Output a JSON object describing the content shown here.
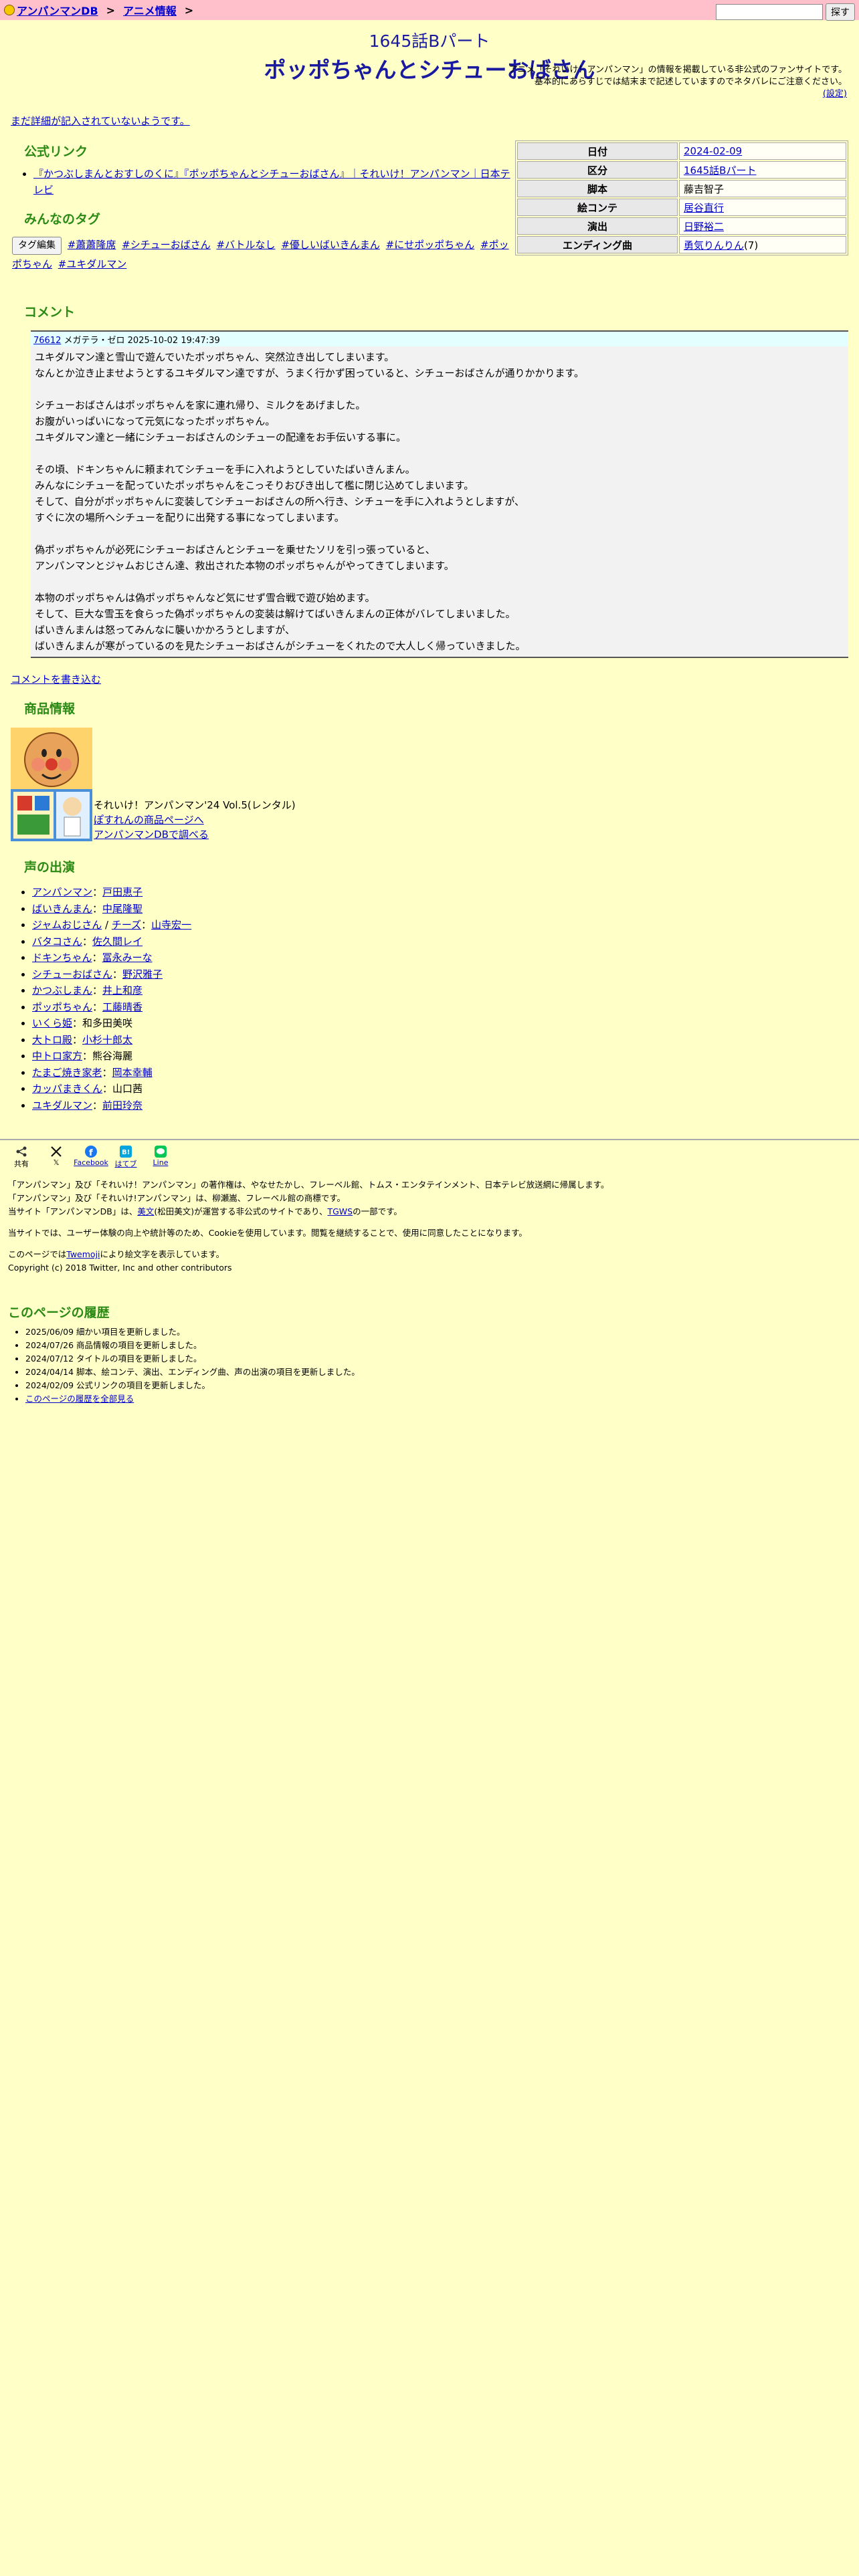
{
  "nav": {
    "crumbs": [
      "アンパンマンDB",
      "アニメ情報"
    ],
    "separator": ">",
    "search_button": "探す"
  },
  "page": {
    "subtitle": "1645話Bパート",
    "title": "ポッポちゃんとシチューおばさん",
    "notice_line1": "アニメ「それいけ！アンパンマン」の情報を掲載している非公式のファンサイトです。",
    "notice_line2": "基本的にあらすじでは結末まで記述していますのでネタバレにご注意ください。",
    "settings_link": "(設定)",
    "no_detail": "まだ詳細が記入されていないようです。"
  },
  "official_links": {
    "heading": "公式リンク",
    "items": [
      "『かつぶしまんとおすしのくに』『ポッポちゃんとシチューおばさん』｜それいけ！アンパンマン｜日本テレビ"
    ]
  },
  "tags": {
    "heading": "みんなのタグ",
    "edit_button": "タグ編集",
    "items": [
      "#蕭蕭隆席",
      "#シチューおばさん",
      "#バトルなし",
      "#優しいばいきんまん",
      "#にせポッポちゃん",
      "#ポッポちゃん",
      "#ユキダルマン"
    ]
  },
  "info": {
    "rows": [
      {
        "label": "日付",
        "value": "2024-02-09",
        "link": true
      },
      {
        "label": "区分",
        "value": "1645話Bパート",
        "link": true
      },
      {
        "label": "脚本",
        "value": "藤吉智子",
        "link": false
      },
      {
        "label": "絵コンテ",
        "value": "居谷直行",
        "link": true
      },
      {
        "label": "演出",
        "value": "日野裕二",
        "link": true
      },
      {
        "label": "エンディング曲",
        "value": "勇気りんりん",
        "suffix": "(7)",
        "link": true
      }
    ]
  },
  "comments": {
    "heading": "コメント",
    "items": [
      {
        "id": "76612",
        "author": "メガテラ・ゼロ",
        "date": "2025-10-02 19:47:39",
        "body": "ユキダルマン達と雪山で遊んでいたポッポちゃん、突然泣き出してしまいます。\nなんとか泣き止ませようとするユキダルマン達ですが、うまく行かず困っていると、シチューおばさんが通りかかります。\n\nシチューおばさんはポッポちゃんを家に連れ帰り、ミルクをあげました。\nお腹がいっぱいになって元気になったポッポちゃん。\nユキダルマン達と一緒にシチューおばさんのシチューの配達をお手伝いする事に。\n\nその頃、ドキンちゃんに頼まれてシチューを手に入れようとしていたばいきんまん。\nみんなにシチューを配っていたポッポちゃんをこっそりおびき出して檻に閉じ込めてしまいます。\nそして、自分がポッポちゃんに変装してシチューおばさんの所へ行き、シチューを手に入れようとしますが、\nすぐに次の場所へシチューを配りに出発する事になってしまいます。\n\n偽ポッポちゃんが必死にシチューおばさんとシチューを乗せたソリを引っ張っていると、\nアンパンマンとジャムおじさん達、救出された本物のポッポちゃんがやってきてしまいます。\n\n本物のポッポちゃんは偽ポッポちゃんなど気にせず雪合戦で遊び始めます。\nそして、巨大な雪玉を食らった偽ポッポちゃんの変装は解けてばいきんまんの正体がバレてしまいました。\nばいきんまんは怒ってみんなに襲いかかろうとしますが、\nばいきんまんが寒がっているのを見たシチューおばさんがシチューをくれたので大人しく帰っていきました。"
      }
    ],
    "write_link": "コメントを書き込む"
  },
  "product": {
    "heading": "商品情報",
    "name": "それいけ！アンパンマン'24 Vol.5(レンタル)",
    "link1": "ぽすれんの商品ページへ",
    "link2": "アンパンマンDBで調べる"
  },
  "voices": {
    "heading": "声の出演",
    "items": [
      {
        "roles": [
          "アンパンマン"
        ],
        "actors": [
          "戸田恵子"
        ]
      },
      {
        "roles": [
          "ばいきんまん"
        ],
        "actors": [
          "中尾隆聖"
        ]
      },
      {
        "roles": [
          "ジャムおじさん",
          "チーズ"
        ],
        "actors": [
          "山寺宏一"
        ]
      },
      {
        "roles": [
          "バタコさん"
        ],
        "actors": [
          "佐久間レイ"
        ]
      },
      {
        "roles": [
          "ドキンちゃん"
        ],
        "actors": [
          "冨永みーな"
        ]
      },
      {
        "roles": [
          "シチューおばさん"
        ],
        "actors": [
          "野沢雅子"
        ]
      },
      {
        "roles": [
          "かつぶしまん"
        ],
        "actors": [
          "井上和彦"
        ]
      },
      {
        "roles": [
          "ポッポちゃん"
        ],
        "actors": [
          "工藤晴香"
        ]
      },
      {
        "roles": [
          "いくら姫"
        ],
        "actors": [
          "和多田美咲"
        ],
        "actor_plain": true
      },
      {
        "roles": [
          "大トロ殿"
        ],
        "actors": [
          "小杉十郎太"
        ]
      },
      {
        "roles": [
          "中トロ家方"
        ],
        "actors": [
          "熊谷海麗"
        ],
        "actor_plain": true
      },
      {
        "roles": [
          "たまご焼き家老"
        ],
        "actors": [
          "岡本幸輔"
        ]
      },
      {
        "roles": [
          "カッパまきくん"
        ],
        "actors": [
          "山口茜"
        ],
        "actor_plain": true
      },
      {
        "roles": [
          "ユキダルマン"
        ],
        "actors": [
          "前田玲奈"
        ]
      }
    ]
  },
  "share": {
    "items": [
      {
        "icon": "share-icon",
        "label": "共有"
      },
      {
        "icon": "x-icon",
        "label": "𝕏"
      },
      {
        "icon": "facebook-icon",
        "label": "Facebook"
      },
      {
        "icon": "hatena-icon",
        "label": "はてブ"
      },
      {
        "icon": "line-icon",
        "label": "Line"
      }
    ]
  },
  "footer": {
    "copyright1": "「アンパンマン」及び「それいけ！アンパンマン」の著作権は、やなせたかし、フレーベル館、トムス・エンタテインメント、日本テレビ放送網に帰属します。",
    "copyright2": "「アンパンマン」及び「それいけ!アンパンマン」は、柳瀬嵩、フレーベル館の商標です。",
    "site_note_pre": "当サイト「アンパンマンDB」は、",
    "site_note_link1": "美文",
    "site_note_mid": "(松田美文)が運営する非公式のサイトであり、",
    "site_note_link2": "TGWS",
    "site_note_post": "の一部です。",
    "cookie": "当サイトでは、ユーザー体験の向上や統計等のため、Cookieを使用しています。閲覧を継続することで、使用に同意したことになります。",
    "twemoji_pre": "このページでは",
    "twemoji_link": "Twemoji",
    "twemoji_post": "により絵文字を表示しています。",
    "twitter_copy": "Copyright (c) 2018 Twitter, Inc and other contributors"
  },
  "history": {
    "heading": "このページの履歴",
    "items": [
      "2025/06/09 細かい項目を更新しました。",
      "2024/07/26 商品情報の項目を更新しました。",
      "2024/07/12 タイトルの項目を更新しました。",
      "2024/04/14 脚本、絵コンテ、演出、エンディング曲、声の出演の項目を更新しました。",
      "2024/02/09 公式リンクの項目を更新しました。"
    ],
    "all_link": "このページの履歴を全部見る"
  }
}
